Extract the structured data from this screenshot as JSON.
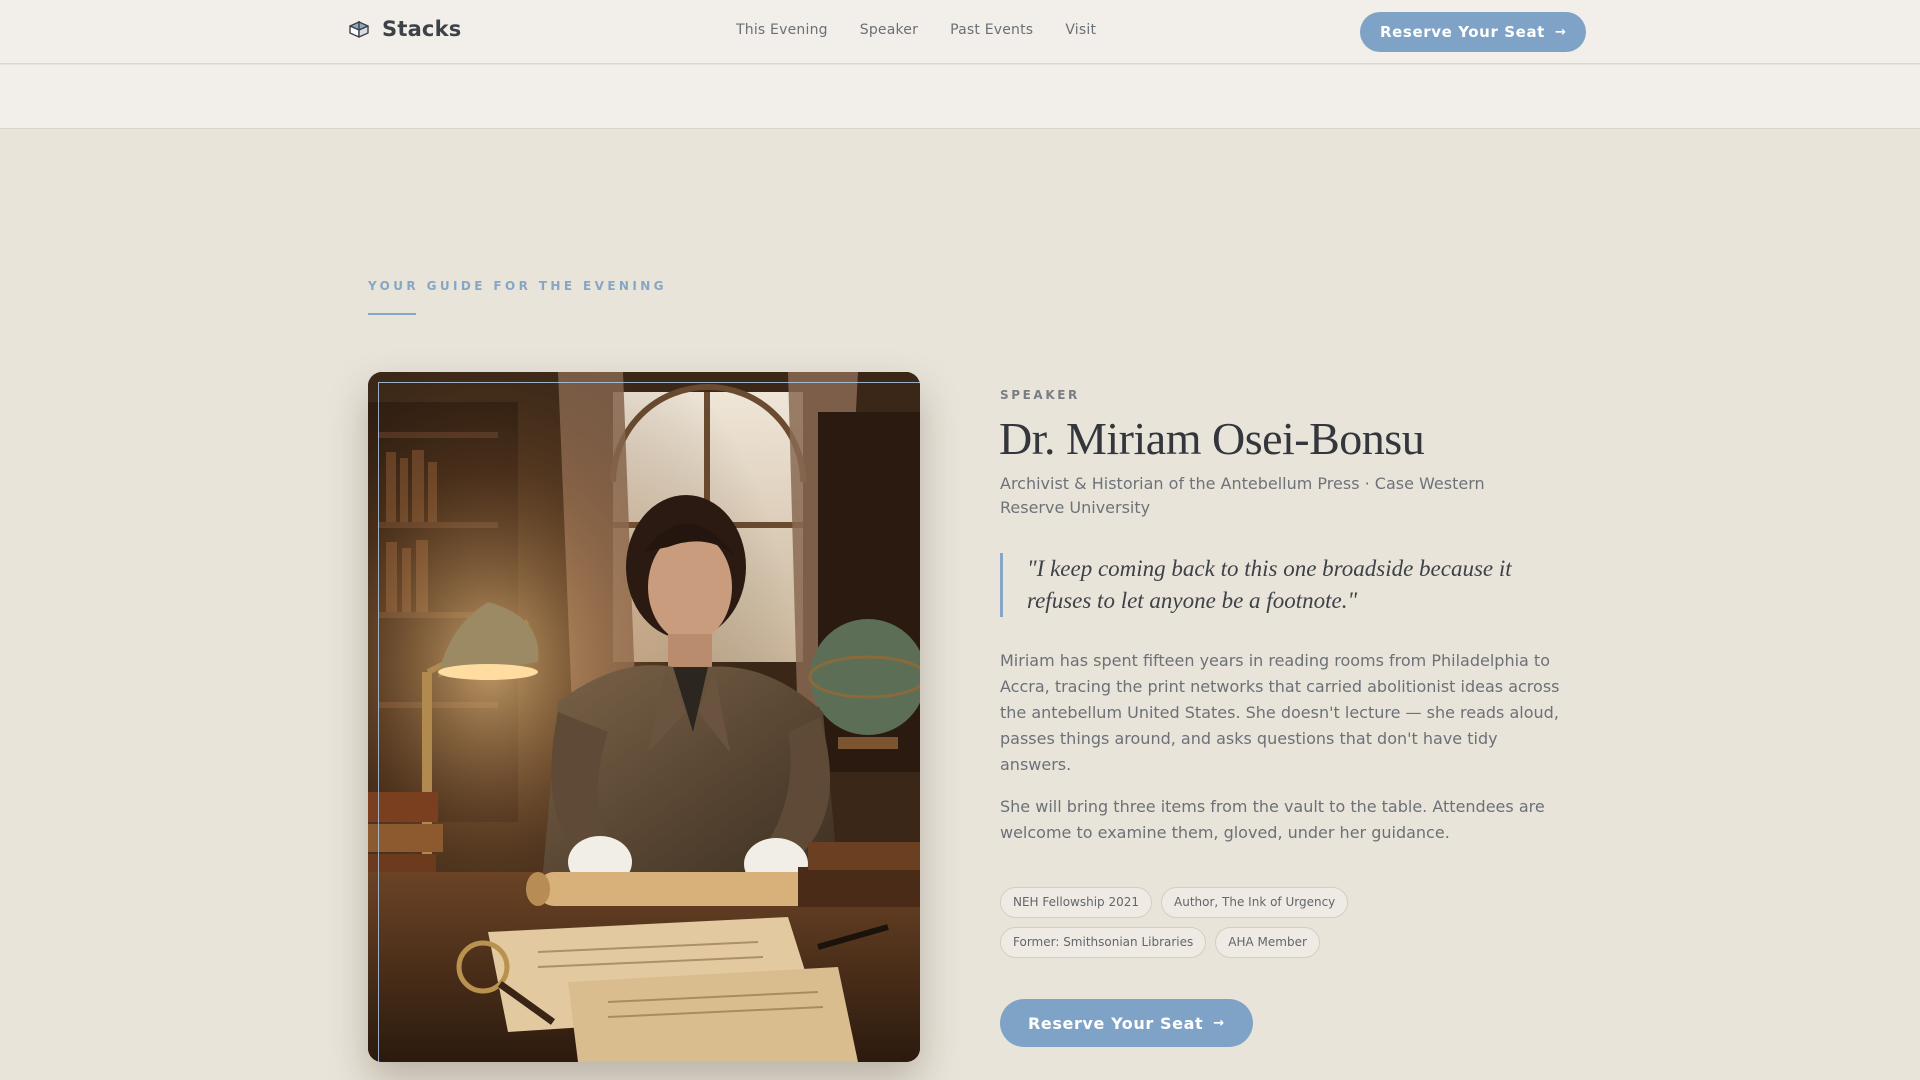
{
  "header": {
    "brand": "Stacks",
    "brand_icon": "book-stack-icon",
    "nav": [
      "This Evening",
      "Speaker",
      "Past Events",
      "Visit"
    ],
    "cta_label": "Reserve Your Seat",
    "cta_icon": "arrow-right-icon"
  },
  "section": {
    "eyebrow": "YOUR GUIDE FOR THE EVENING"
  },
  "speaker": {
    "role": "SPEAKER",
    "name": "Dr. Miriam Osei-Bonsu",
    "title": "Archivist & Historian of the Antebellum Press · Case Western Reserve University",
    "quote": "\"I keep coming back to this one broadside because it refuses to let anyone be a footnote.\"",
    "bio": [
      "Miriam has spent fifteen years in reading rooms from Philadelphia to Accra, tracing the print networks that carried abolitionist ideas across the antebellum United States. She doesn't lecture — she reads aloud, passes things around, and asks questions that don't have tidy answers.",
      "She will bring three items from the vault to the table. Attendees are welcome to examine them, gloved, under her guidance."
    ],
    "tags": [
      "NEH Fellowship 2021",
      "Author, The Ink of Urgency",
      "Former: Smithsonian Libraries",
      "AHA Member"
    ],
    "cta_label": "Reserve Your Seat",
    "photo_icon": "speaker-portrait-image"
  },
  "colors": {
    "accent": "#7fa3c7",
    "background": "#e9e4da",
    "header": "#f2efea"
  }
}
